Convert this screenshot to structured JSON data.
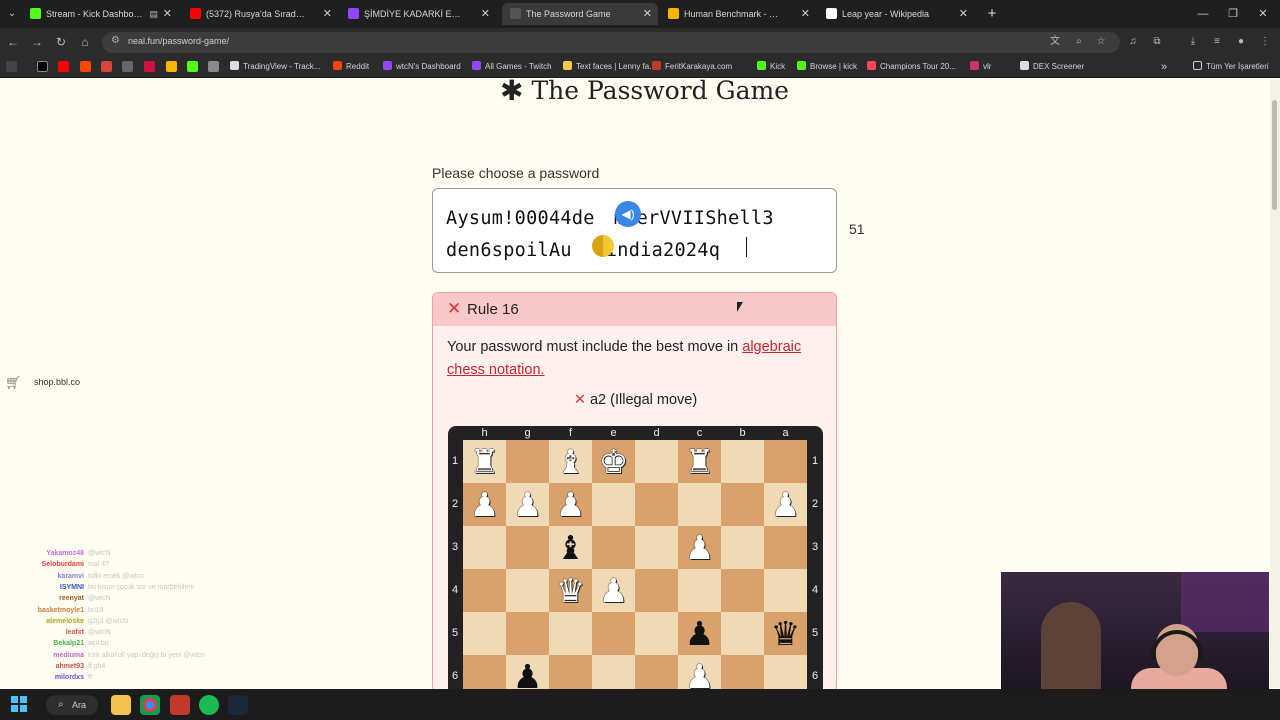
{
  "browser": {
    "tabs": [
      {
        "label": "Stream - Kick Dashboard",
        "color": "#53fc18",
        "active": false,
        "extra": "▤"
      },
      {
        "label": "(5372) Rusya'da Sıradan Bir Gü",
        "color": "#ff0000",
        "active": false,
        "extra": ""
      },
      {
        "label": "ŞİMDİYE KADARKİ EN İYİ OYUN",
        "color": "#9146ff",
        "active": false,
        "extra": ""
      },
      {
        "label": "The Password Game",
        "color": "#555555",
        "active": true,
        "extra": ""
      },
      {
        "label": "Human Benchmark - Chimp Tes",
        "color": "#f7b500",
        "active": false,
        "extra": ""
      },
      {
        "label": "Leap year - Wikipedia",
        "color": "#ffffff",
        "active": false,
        "extra": ""
      }
    ],
    "new_tab_label": "+",
    "url": "neal.fun/password-game/"
  },
  "bookmarks": {
    "items": [
      {
        "label": "TradingView - Track...",
        "color": "#dddddd"
      },
      {
        "label": "Reddit",
        "color": "#ff4500"
      },
      {
        "label": "wtcN's Dashboard",
        "color": "#9146ff"
      },
      {
        "label": "All Games - Twitch",
        "color": "#9146ff"
      },
      {
        "label": "Text faces | Lenny fa...",
        "color": "#f2c94c"
      },
      {
        "label": "FeritKarakaya.com",
        "color": "#c0392b"
      },
      {
        "label": "Kick",
        "color": "#53fc18"
      },
      {
        "label": "Browse | kick",
        "color": "#53fc18"
      },
      {
        "label": "Champions Tour 20...",
        "color": "#ff4655"
      },
      {
        "label": "vlr",
        "color": "#cc3366"
      },
      {
        "label": "DEX Screener",
        "color": "#dddddd"
      }
    ],
    "more_label": "»",
    "all_bookmarks": "Tüm Yer İşaretleri"
  },
  "page": {
    "title_star": "✱",
    "title": "The Password Game",
    "password_label": "Please choose a password",
    "password_line1_a": "Aysum!00044de",
    "password_line1_b": "mberVVIIShell3",
    "password_line2_a": "den6spoilAu",
    "password_line2_b": "india2024q",
    "char_count": "51",
    "rule": {
      "status_icon": "✕",
      "title": "Rule 16",
      "desc_prefix": "Your password must include the best move in ",
      "desc_link": "algebraic chess notation.",
      "move_icon": "✕",
      "move_text": "a2 (Illegal move)"
    },
    "board": {
      "files": [
        "h",
        "g",
        "f",
        "e",
        "d",
        "c",
        "b",
        "a"
      ],
      "ranks": [
        "1",
        "2",
        "3",
        "4",
        "5",
        "6"
      ],
      "pieces": [
        {
          "sq": "h1",
          "glyph": "♜",
          "side": "w",
          "name": "white-rook"
        },
        {
          "sq": "f1",
          "glyph": "♝",
          "side": "w",
          "name": "white-bishop"
        },
        {
          "sq": "e1",
          "glyph": "♚",
          "side": "w",
          "name": "white-king"
        },
        {
          "sq": "c1",
          "glyph": "♜",
          "side": "w",
          "name": "white-rook"
        },
        {
          "sq": "h2",
          "glyph": "♟",
          "side": "w",
          "name": "white-pawn"
        },
        {
          "sq": "g2",
          "glyph": "♟",
          "side": "w",
          "name": "white-pawn"
        },
        {
          "sq": "f2",
          "glyph": "♟",
          "side": "w",
          "name": "white-pawn"
        },
        {
          "sq": "a2",
          "glyph": "♟",
          "side": "w",
          "name": "white-pawn"
        },
        {
          "sq": "f3",
          "glyph": "♝",
          "side": "b",
          "name": "black-bishop"
        },
        {
          "sq": "c3",
          "glyph": "♟",
          "side": "w",
          "name": "white-pawn"
        },
        {
          "sq": "f4",
          "glyph": "♛",
          "side": "w",
          "name": "white-queen"
        },
        {
          "sq": "e4",
          "glyph": "♟",
          "side": "w",
          "name": "white-pawn"
        },
        {
          "sq": "c5",
          "glyph": "♟",
          "side": "b",
          "name": "black-pawn"
        },
        {
          "sq": "a5",
          "glyph": "♛",
          "side": "b",
          "name": "black-queen"
        },
        {
          "sq": "g6",
          "glyph": "♟",
          "side": "b",
          "name": "black-pawn"
        },
        {
          "sq": "c6",
          "glyph": "♟",
          "side": "w",
          "name": "white-pawn"
        }
      ]
    }
  },
  "overlay": {
    "shop": "shop.bbl.co",
    "chat": [
      {
        "name": "Yakamoz48",
        "color": "#c070e0",
        "msg": "@wtcN"
      },
      {
        "name": "Seloburdami",
        "color": "#e04040",
        "msg": "mal 4?"
      },
      {
        "name": "karamvi",
        "color": "#8a7cd0",
        "msg": "tüfkt emek @wtcn"
      },
      {
        "name": "ISYMNI",
        "color": "#3355cc",
        "msg": "bu kısım çocuk sor ve marbebileni"
      },
      {
        "name": "reenyat",
        "color": "#a06020",
        "msg": "@wtcN"
      },
      {
        "name": "basketmoyle1",
        "color": "#c08040",
        "msg": "bu19"
      },
      {
        "name": "alemeloske",
        "color": "#b0a020",
        "msg": "g2g3 @wtcN"
      },
      {
        "name": "leafxt",
        "color": "#e05050",
        "msg": "@wtcN"
      },
      {
        "name": "Bekalp21",
        "color": "#4caf50",
        "msg": "açıl bu"
      },
      {
        "name": "mediuma",
        "color": "#c06ad0",
        "msg": "türk alkol oll yapı değiş bı yeni @wtcn"
      },
      {
        "name": "ahmet93",
        "color": "#c05050",
        "msg": "ff gb4"
      },
      {
        "name": "milordxs",
        "color": "#6a50d0",
        "msg": "ff"
      }
    ]
  },
  "taskbar": {
    "search_label": "Ara"
  }
}
